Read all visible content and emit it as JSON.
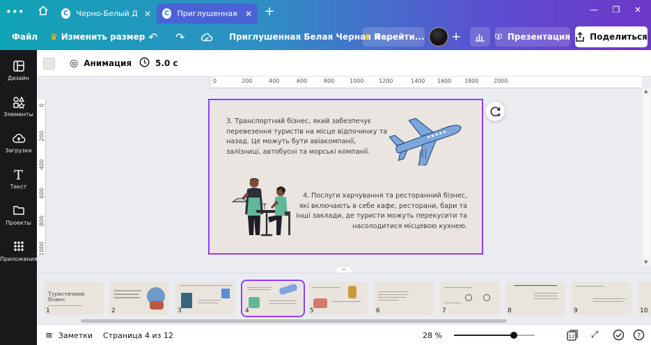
{
  "browser": {
    "tabs": [
      {
        "label": "Черно-Белый Дет...",
        "favicon": "C",
        "active": false
      },
      {
        "label": "Приглушенная Бе...",
        "favicon": "C",
        "active": true
      }
    ],
    "new_tab": "+"
  },
  "toolbar": {
    "file_label": "Файл",
    "resize_label": "Изменить размер",
    "doc_title": "Приглушенная Белая Черная и ...",
    "upgrade_label": "Перейти...",
    "present_label": "Презентация",
    "share_label": "Поделиться"
  },
  "sidebar": {
    "items": [
      {
        "label": "Дизайн",
        "icon": "design-icon"
      },
      {
        "label": "Элементы",
        "icon": "elements-icon"
      },
      {
        "label": "Загрузки",
        "icon": "upload-icon"
      },
      {
        "label": "Текст",
        "icon": "text-icon"
      },
      {
        "label": "Проекты",
        "icon": "folder-icon"
      },
      {
        "label": "Приложения",
        "icon": "apps-icon"
      }
    ]
  },
  "context": {
    "background_color": "#ebe6e1",
    "animation_label": "Анимация",
    "duration_label": "5.0 с"
  },
  "ruler": {
    "top": [
      "0",
      "200",
      "400",
      "600",
      "800",
      "1000",
      "1200",
      "1400",
      "1600",
      "1800",
      "2000"
    ],
    "left": [
      "0",
      "200",
      "400",
      "600",
      "800",
      "1000"
    ]
  },
  "slide": {
    "text_1": "3. Транспортний бізнес, який забезпечує перевезення туристів на місце відпочинку та назад. Це можуть бути авіакомпанії, залізниці, автобусні та морські компанії.",
    "text_2": "4. Послуги харчування та ресторанний бізнес, які включають в себе кафе, ресторани, бари та інші заклади, де туристи можуть перекусити та насолодитися місцевою кухнею."
  },
  "filmstrip": {
    "thumbs": [
      {
        "num": "1",
        "title": "Туристичний бізнес"
      },
      {
        "num": "2"
      },
      {
        "num": "3"
      },
      {
        "num": "4"
      },
      {
        "num": "5"
      },
      {
        "num": "6"
      },
      {
        "num": "7"
      },
      {
        "num": "8"
      },
      {
        "num": "9"
      },
      {
        "num": "10"
      }
    ],
    "active_index": 3
  },
  "bottom": {
    "notes_label": "Заметки",
    "page_label": "Страница 4 из 12",
    "zoom_label": "28 %",
    "zoom_fraction": 0.28,
    "page_count": "12"
  },
  "colors": {
    "accent": "#8b3dff",
    "slide_bg": "#eae5e0",
    "plane": "#7da7dc"
  }
}
